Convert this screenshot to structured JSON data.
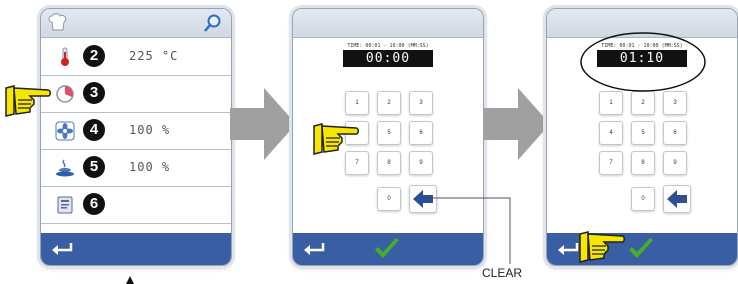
{
  "panel1": {
    "rows": [
      {
        "num": "2",
        "value": "225 °C",
        "icon": "thermometer-icon"
      },
      {
        "num": "3",
        "value": "",
        "icon": "timer-icon"
      },
      {
        "num": "4",
        "value": "100 %",
        "icon": "fan-icon"
      },
      {
        "num": "5",
        "value": "100 %",
        "icon": "steam-icon"
      },
      {
        "num": "6",
        "value": "",
        "icon": "recipe-book-icon"
      }
    ]
  },
  "panel2": {
    "caption": "TIME: 00:01 - 10:00 (MM:SS)",
    "display": "00:00",
    "keys": [
      "1",
      "2",
      "3",
      "4",
      "5",
      "6",
      "7",
      "8",
      "9",
      "0"
    ]
  },
  "panel3": {
    "caption": "TIME: 00:01 - 10:00 (MM:SS)",
    "display": "01:10",
    "keys": [
      "1",
      "2",
      "3",
      "4",
      "5",
      "6",
      "7",
      "8",
      "9",
      "0"
    ]
  },
  "callout": {
    "clear_label": "CLEAR"
  },
  "colors": {
    "bar_blue": "#3a5ea3",
    "check_green": "#43b02a",
    "hand_yellow": "#f7e600",
    "arrow_gray": "#a0a0a0"
  }
}
